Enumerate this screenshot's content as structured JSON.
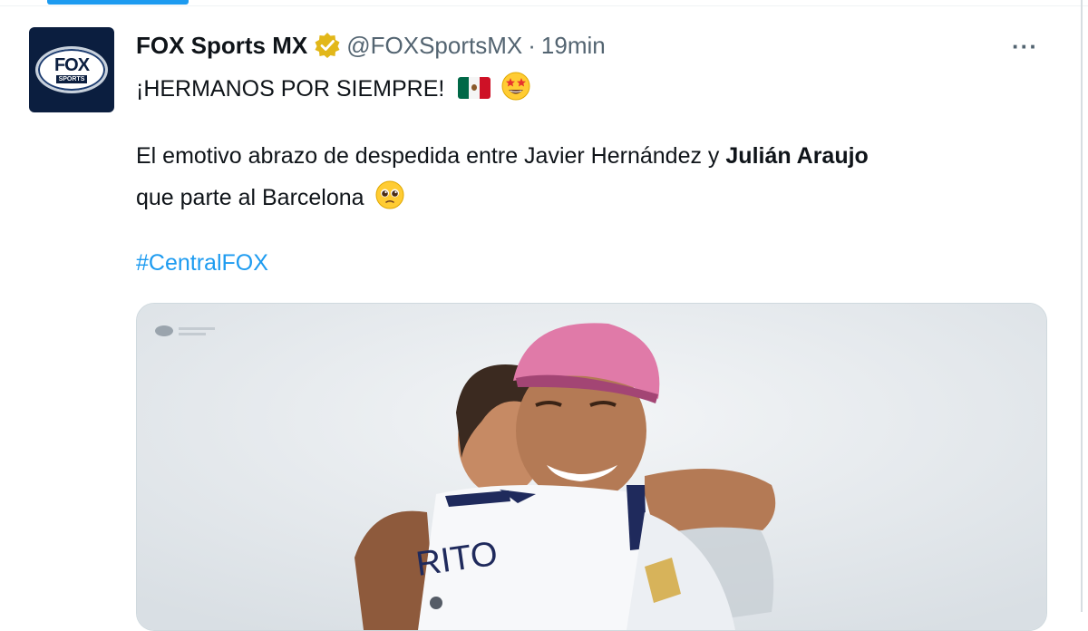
{
  "tweet": {
    "display_name": "FOX Sports MX",
    "handle": "@FOXSportsMX",
    "separator": "·",
    "time": "19min",
    "more_label": "···",
    "text_line1": "¡HERMANOS POR SIEMPRE!",
    "text_line2_prefix": "El emotivo abrazo de despedida entre Javier Hernández y ",
    "text_line2_bold": "Julián Araujo",
    "text_line3": "que parte al Barcelona",
    "hashtag": "#CentralFOX"
  },
  "avatar": {
    "logo_top": "FOX",
    "logo_bottom": "SPORTS"
  },
  "media": {
    "jersey_text": "RITO"
  },
  "colors": {
    "accent": "#1d9bf0",
    "verified": "#e2b719",
    "text": "#0f1419",
    "secondary": "#536471"
  },
  "icons": [
    "verified-badge-icon",
    "more-options-icon",
    "mexico-flag-icon",
    "star-struck-emoji-icon",
    "pleading-face-emoji-icon"
  ]
}
